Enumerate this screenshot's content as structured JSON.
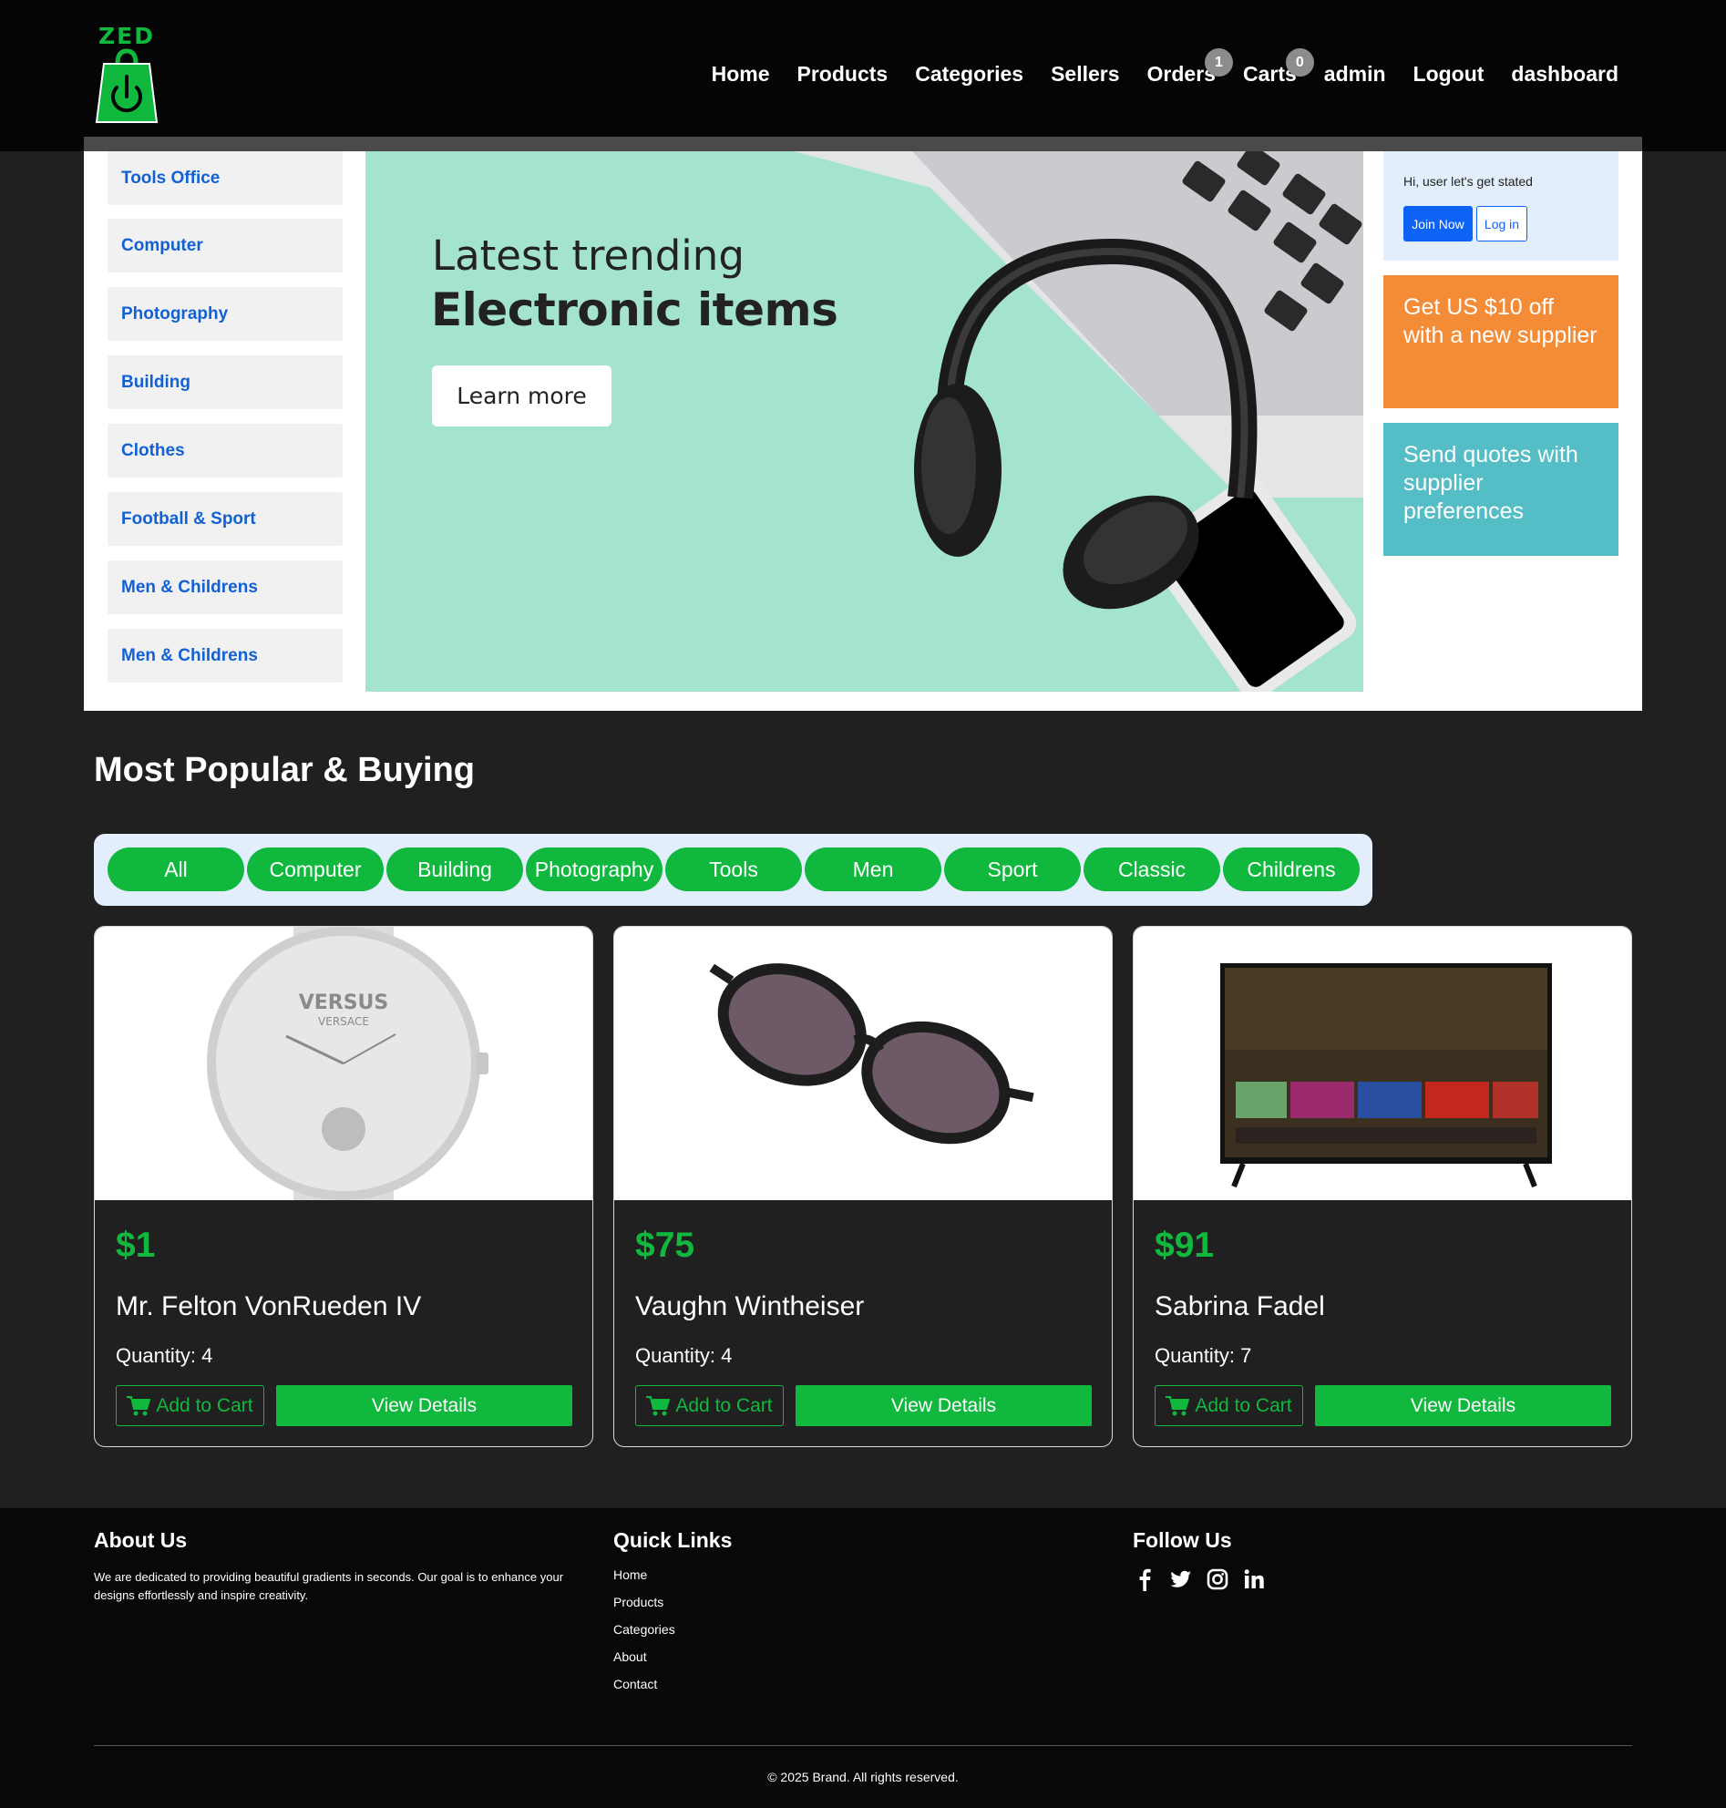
{
  "brand": {
    "logo_text": "ZED",
    "brand_color": "#10b83e"
  },
  "nav": {
    "items": [
      {
        "label": "Home"
      },
      {
        "label": "Products"
      },
      {
        "label": "Categories"
      },
      {
        "label": "Sellers"
      },
      {
        "label": "Orders",
        "badge": "1"
      },
      {
        "label": "Carts",
        "badge": "0"
      },
      {
        "label": "admin"
      },
      {
        "label": "Logout"
      },
      {
        "label": "dashboard"
      }
    ]
  },
  "sidebar": {
    "categories": [
      "Tools Office",
      "Computer",
      "Photography",
      "Building",
      "Clothes",
      "Football & Sport",
      "Men & Childrens",
      "Men & Childrens"
    ]
  },
  "banner": {
    "line1": "Latest trending",
    "line2": "Electronic items",
    "button": "Learn more",
    "background_color": "#a4e3cf"
  },
  "account": {
    "greeting": "Hi, user let's get stated",
    "join_label": "Join Now",
    "login_label": "Log in"
  },
  "promos": [
    {
      "text": "Get US $10 off with a new supplier",
      "color": "#f38b37"
    },
    {
      "text": "Send quotes with supplier preferences",
      "color": "#55bdc6"
    }
  ],
  "popular": {
    "title": "Most Popular & Buying",
    "filters": [
      "All",
      "Computer",
      "Building",
      "Photography",
      "Tools",
      "Men",
      "Sport",
      "Classic",
      "Childrens"
    ],
    "products": [
      {
        "price": "$1",
        "name": "Mr. Felton VonRueden IV",
        "quantity": "Quantity: 4",
        "image": "watch-image",
        "cart_label": "Add to Cart",
        "details_label": "View Details"
      },
      {
        "price": "$75",
        "name": "Vaughn Wintheiser",
        "quantity": "Quantity: 4",
        "image": "sunglasses-image",
        "cart_label": "Add to Cart",
        "details_label": "View Details"
      },
      {
        "price": "$91",
        "name": "Sabrina Fadel",
        "quantity": "Quantity: 7",
        "image": "tv-image",
        "cart_label": "Add to Cart",
        "details_label": "View Details"
      }
    ]
  },
  "footer": {
    "about_title": "About Us",
    "about_text": "We are dedicated to providing beautiful gradients in seconds. Our goal is to enhance your designs effortlessly and inspire creativity.",
    "links_title": "Quick Links",
    "links": [
      "Home",
      "Products",
      "Categories",
      "About",
      "Contact"
    ],
    "follow_title": "Follow Us",
    "social": [
      "facebook-icon",
      "twitter-icon",
      "instagram-icon",
      "linkedin-icon"
    ],
    "copyright": "© 2025 Brand. All rights reserved."
  }
}
